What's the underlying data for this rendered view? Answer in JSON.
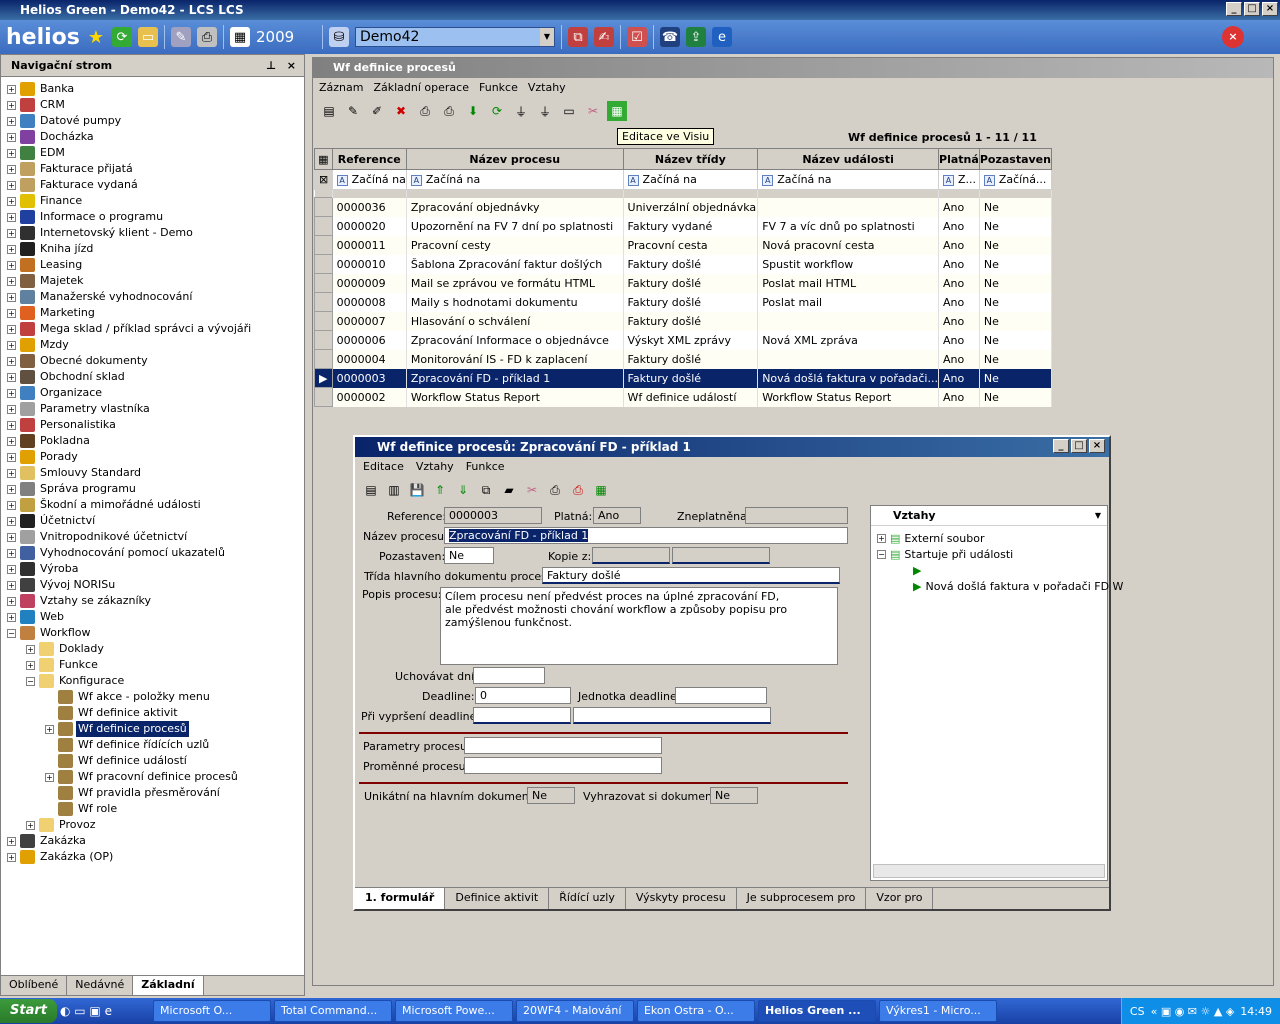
{
  "window": {
    "title": "Helios Green - Demo42 - LCS LCS"
  },
  "toolbar": {
    "year": "2009",
    "database": "Demo42"
  },
  "nav": {
    "header": "Navigační strom",
    "items": [
      {
        "label": "Banka",
        "color": "#e0a000",
        "plus": "+"
      },
      {
        "label": "CRM",
        "color": "#c04040",
        "plus": "+"
      },
      {
        "label": "Datové pumpy",
        "color": "#4080c0",
        "plus": "+"
      },
      {
        "label": "Docházka",
        "color": "#8040a0",
        "plus": "+"
      },
      {
        "label": "EDM",
        "color": "#408040",
        "plus": "+"
      },
      {
        "label": "Fakturace přijatá",
        "color": "#c0a060",
        "plus": "+"
      },
      {
        "label": "Fakturace vydaná",
        "color": "#c0a060",
        "plus": "+"
      },
      {
        "label": "Finance",
        "color": "#e0c000",
        "plus": "+"
      },
      {
        "label": "Informace o programu",
        "color": "#2040a0",
        "plus": "+"
      },
      {
        "label": "Internetovský klient - Demo",
        "color": "#303030",
        "plus": "+"
      },
      {
        "label": "Kniha jízd",
        "color": "#202020",
        "plus": "+"
      },
      {
        "label": "Leasing",
        "color": "#c07020",
        "plus": "+"
      },
      {
        "label": "Majetek",
        "color": "#806040",
        "plus": "+"
      },
      {
        "label": "Manažerské vyhodnocování",
        "color": "#6080a0",
        "plus": "+"
      },
      {
        "label": "Marketing",
        "color": "#e06020",
        "plus": "+"
      },
      {
        "label": "Mega sklad / příklad správci a vývojáři",
        "color": "#c04040",
        "plus": "+"
      },
      {
        "label": "Mzdy",
        "color": "#e0a000",
        "plus": "+"
      },
      {
        "label": "Obecné dokumenty",
        "color": "#806040",
        "plus": "+"
      },
      {
        "label": "Obchodní sklad",
        "color": "#605040",
        "plus": "+"
      },
      {
        "label": "Organizace",
        "color": "#4080c0",
        "plus": "+"
      },
      {
        "label": "Parametry vlastníka",
        "color": "#a0a0a0",
        "plus": "+"
      },
      {
        "label": "Personalistika",
        "color": "#c04040",
        "plus": "+"
      },
      {
        "label": "Pokladna",
        "color": "#604020",
        "plus": "+"
      },
      {
        "label": "Porady",
        "color": "#e0a000",
        "plus": "+"
      },
      {
        "label": "Smlouvy Standard",
        "color": "#e0c060",
        "plus": "+"
      },
      {
        "label": "Správa programu",
        "color": "#808080",
        "plus": "+"
      },
      {
        "label": "Škodní a mimořádné události",
        "color": "#c0a040",
        "plus": "+"
      },
      {
        "label": "Účetnictví",
        "color": "#202020",
        "plus": "+"
      },
      {
        "label": "Vnitropodnikové účetnictví",
        "color": "#a0a0a0",
        "plus": "+"
      },
      {
        "label": "Vyhodnocování pomocí ukazatelů",
        "color": "#4060a0",
        "plus": "+"
      },
      {
        "label": "Výroba",
        "color": "#303030",
        "plus": "+"
      },
      {
        "label": "Vývoj NORISu",
        "color": "#404040",
        "plus": "+"
      },
      {
        "label": "Vztahy se zákazníky",
        "color": "#c04060",
        "plus": "+"
      },
      {
        "label": "Web",
        "color": "#2080c0",
        "plus": "+"
      },
      {
        "label": "Workflow",
        "color": "#c08040",
        "plus": "−"
      },
      {
        "label": "Doklady",
        "color": "#f0d070",
        "plus": "+",
        "indent": 1
      },
      {
        "label": "Funkce",
        "color": "#f0d070",
        "plus": "+",
        "indent": 1
      },
      {
        "label": "Konfigurace",
        "color": "#f0d070",
        "plus": "−",
        "indent": 1
      },
      {
        "label": "Wf akce - položky menu",
        "color": "#a08040",
        "plus": "",
        "indent": 2
      },
      {
        "label": "Wf definice aktivit",
        "color": "#a08040",
        "plus": "",
        "indent": 2
      },
      {
        "label": "Wf definice procesů",
        "color": "#a08040",
        "plus": "+",
        "indent": 2,
        "selected": true
      },
      {
        "label": "Wf definice řídících uzlů",
        "color": "#a08040",
        "plus": "",
        "indent": 2
      },
      {
        "label": "Wf definice událostí",
        "color": "#a08040",
        "plus": "",
        "indent": 2
      },
      {
        "label": "Wf pracovní definice procesů",
        "color": "#a08040",
        "plus": "+",
        "indent": 2
      },
      {
        "label": "Wf pravidla přesměrování",
        "color": "#a08040",
        "plus": "",
        "indent": 2
      },
      {
        "label": "Wf role",
        "color": "#a08040",
        "plus": "",
        "indent": 2
      },
      {
        "label": "Provoz",
        "color": "#f0d070",
        "plus": "+",
        "indent": 1
      },
      {
        "label": "Zakázka",
        "color": "#404040",
        "plus": "+"
      },
      {
        "label": "Zakázka (OP)",
        "color": "#e0a000",
        "plus": "+"
      }
    ],
    "tabs": [
      "Oblíbené",
      "Nedávné",
      "Základní"
    ]
  },
  "main": {
    "title": "Wf definice procesů",
    "menu": [
      "Záznam",
      "Základní operace",
      "Funkce",
      "Vztahy"
    ],
    "tooltip": "Editace ve Visiu",
    "grid_title": "Wf definice procesů  1 - 11 / 11",
    "columns": [
      "Reference",
      "Název procesu",
      "Název třídy",
      "Název události",
      "Platná",
      "Pozastaven"
    ],
    "filters": [
      "Začíná na",
      "Začíná na",
      "Začíná na",
      "Začíná na",
      "Z...",
      "Začíná..."
    ],
    "rows": [
      [
        "0000036",
        "Zpracování objednávky",
        "Univerzální objednávka",
        "",
        "Ano",
        "Ne"
      ],
      [
        "0000020",
        "Upozornění na FV 7 dní po splatnosti",
        "Faktury vydané",
        "FV 7 a víc dnů po splatnosti",
        "Ano",
        "Ne"
      ],
      [
        "0000011",
        "Pracovní cesty",
        "Pracovní cesta",
        "Nová pracovní cesta",
        "Ano",
        "Ne"
      ],
      [
        "0000010",
        "Šablona Zpracování faktur došlých",
        "Faktury došlé",
        "Spustit workflow",
        "Ano",
        "Ne"
      ],
      [
        "0000009",
        "Mail se zprávou ve formátu HTML",
        "Faktury došlé",
        "Poslat mail HTML",
        "Ano",
        "Ne"
      ],
      [
        "0000008",
        "Maily s hodnotami dokumentu",
        "Faktury došlé",
        "Poslat mail",
        "Ano",
        "Ne"
      ],
      [
        "0000007",
        "Hlasování o schválení",
        "Faktury došlé",
        "",
        "Ano",
        "Ne"
      ],
      [
        "0000006",
        "Zpracování Informace o objednávce",
        "Výskyt XML zprávy",
        "Nová XML zpráva",
        "Ano",
        "Ne"
      ],
      [
        "0000004",
        "Monitorování IS - FD k zaplacení",
        "Faktury došlé",
        "",
        "Ano",
        "Ne"
      ],
      [
        "0000003",
        "Zpracování FD - příklad 1",
        "Faktury došlé",
        "Nová došlá faktura v pořadači...",
        "Ano",
        "Ne"
      ],
      [
        "0000002",
        "Workflow Status Report",
        "Wf definice událostí",
        "Workflow Status Report",
        "Ano",
        "Ne"
      ]
    ],
    "selected_row": 9
  },
  "dialog": {
    "title": "Wf definice procesů: Zpracování FD - příklad 1",
    "menu": [
      "Editace",
      "Vztahy",
      "Funkce"
    ],
    "labels": {
      "reference": "Reference:",
      "platna": "Platná:",
      "zneplatnena": "Zneplatněna:",
      "nazev": "Název procesu:",
      "pozastaven": "Pozastaven:",
      "kopie": "Kopie z:",
      "trida": "Třída hlavního dokumentu procesu:",
      "popis": "Popis procesu:",
      "uchovavat": "Uchovávat dní:",
      "deadline": "Deadline:",
      "jednotka": "Jednotka deadline:",
      "vyprseni": "Při vypršení deadline:",
      "parametry": "Parametry procesu:",
      "promenne": "Proměnné procesu:",
      "unikatni": "Unikátní na hlavním dokumentu:",
      "vyhrazovat": "Vyhrazovat si dokument:"
    },
    "values": {
      "reference": "0000003",
      "platna": "Ano",
      "nazev": "Zpracování FD - příklad 1",
      "pozastaven": "Ne",
      "trida": "Faktury došlé",
      "popis": "Cílem procesu není předvést proces na úplné zpracování FD,\nale předvést možnosti chování workflow a způsoby popisu pro zamýšlenou funkčnost.",
      "deadline": "0",
      "unikatni": "Ne",
      "vyhrazovat": "Ne"
    },
    "relations": {
      "header": "Vztahy",
      "items": [
        "Externí soubor",
        "Startuje při události",
        "",
        "Nová došlá faktura v pořadači FD W"
      ]
    },
    "tabs": [
      "1. formulář",
      "Definice aktivit",
      "Řídící uzly",
      "Výskyty procesu",
      "Je subprocesem pro",
      "Vzor pro"
    ]
  },
  "taskbar": {
    "start": "Start",
    "tasks": [
      "Microsoft O...",
      "Total Command...",
      "Microsoft Powe...",
      "20WF4 - Malování",
      "Ekon Ostra - O...",
      "Helios Green ...",
      "Výkres1 - Micro..."
    ],
    "active_task": 5,
    "lang": "CS",
    "clock": "14:49"
  }
}
